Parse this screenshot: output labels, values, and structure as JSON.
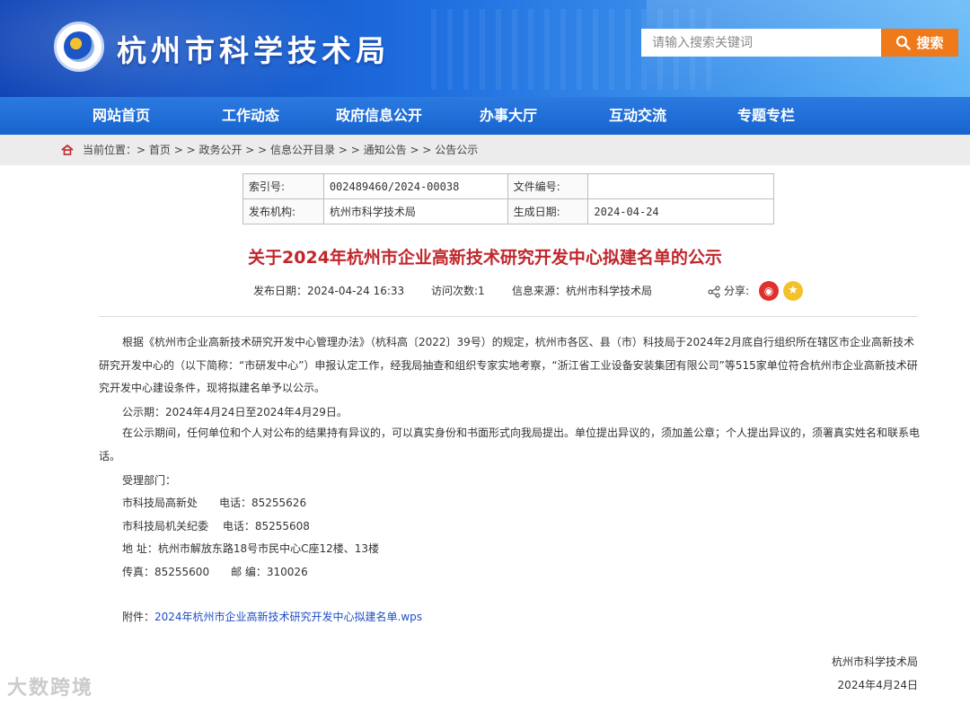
{
  "header": {
    "site_title": "杭州市科学技术局",
    "search_placeholder": "请输入搜索关键词",
    "search_button": "搜索"
  },
  "nav": [
    "网站首页",
    "工作动态",
    "政府信息公开",
    "办事大厅",
    "互动交流",
    "专题专栏"
  ],
  "breadcrumb": {
    "prefix": "当前位置：> ",
    "items": [
      "首页",
      "政务公开",
      "信息公开目录",
      "通知公告",
      "公告公示"
    ],
    "separator": " > > "
  },
  "meta": {
    "index_label": "索引号:",
    "index_value": "002489460/2024-00038",
    "docno_label": "文件编号:",
    "docno_value": "",
    "org_label": "发布机构:",
    "org_value": "杭州市科学技术局",
    "date_label": "生成日期:",
    "date_value": "2024-04-24"
  },
  "article": {
    "title": "关于2024年杭州市企业高新技术研究开发中心拟建名单的公示",
    "publish": "发布日期：2024-04-24 16:33",
    "visits": "访问次数:1",
    "source": "信息来源：杭州市科学技术局",
    "share_label": "分享:",
    "para1": "根据《杭州市企业高新技术研究开发中心管理办法》（杭科高〔2022〕39号）的规定，杭州市各区、县（市）科技局于2024年2月底自行组织所在辖区市企业高新技术研究开发中心的（以下简称：“市研发中心”）申报认定工作，经我局抽查和组织专家实地考察，“浙江省工业设备安装集团有限公司”等515家单位符合杭州市企业高新技术研究开发中心建设条件，现将拟建名单予以公示。",
    "period": "公示期：2024年4月24日至2024年4月29日。",
    "para2": "在公示期间，任何单位和个人对公布的结果持有异议的，可以真实身份和书面形式向我局提出。单位提出异议的，须加盖公章；个人提出异议的，须署真实姓名和联系电话。",
    "dept_label": "受理部门：",
    "contact1": "市科技局高新处　　电话：85255626",
    "contact2": "市科技局机关纪委　 电话：85255608",
    "address": "地  址：杭州市解放东路18号市民中心C座12楼、13楼",
    "fax": "传真：85255600　　邮  编：310026",
    "attach_label": "附件：",
    "attach_link": "2024年杭州市企业高新技术研究开发中心拟建名单.wps",
    "sign_org": "杭州市科学技术局",
    "sign_date": "2024年4月24日"
  },
  "watermark": "大数跨境",
  "colors": {
    "title_red": "#c0272d",
    "nav_blue": "#1f6fdb",
    "search_orange": "#f07a1a",
    "link_blue": "#1f4fc4"
  },
  "icons": [
    "search-icon",
    "home-icon",
    "share-icon",
    "weibo-icon",
    "star-icon"
  ]
}
